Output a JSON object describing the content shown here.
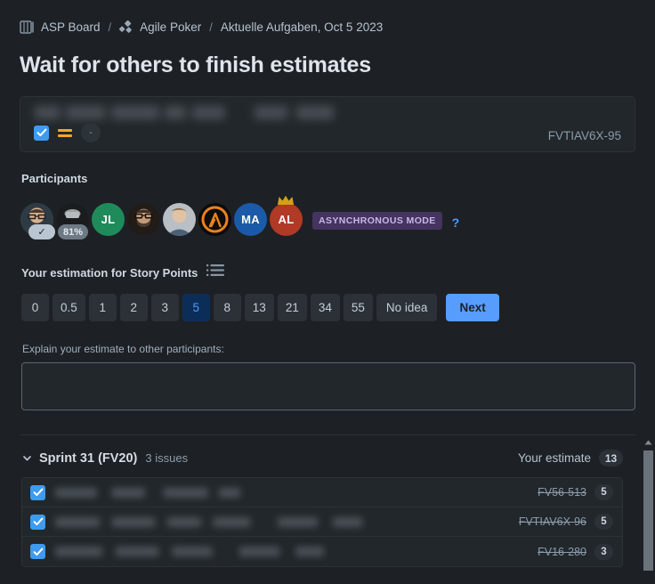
{
  "breadcrumb": {
    "board_icon": "board-icon",
    "board": "ASP Board",
    "sep1": "/",
    "poker_icon": "agile-poker-icon",
    "app": "Agile Poker",
    "sep2": "/",
    "session": "Aktuelle Aufgaben, Oct 5 2023"
  },
  "headline": "Wait for others to finish estimates",
  "issue_card": {
    "title_redacted": true,
    "checkbox_checked": true,
    "priority_icon": "priority-medium-icon",
    "assignee_placeholder": "-",
    "key": "FVTIAV6X-95"
  },
  "participants": {
    "label": "Participants",
    "avatars": [
      {
        "name": "participant-1",
        "type": "photo",
        "badge": "✓",
        "badge_type": "check",
        "color": "#3c4a55"
      },
      {
        "name": "participant-2",
        "type": "photo",
        "badge": "81%",
        "badge_type": "percent",
        "color": "#2a2d30"
      },
      {
        "name": "participant-3",
        "type": "initials",
        "initials": "JL",
        "color": "#1f8b5a"
      },
      {
        "name": "participant-4",
        "type": "photo",
        "color": "#2b2521"
      },
      {
        "name": "participant-5",
        "type": "photo",
        "color": "#6d7a86"
      },
      {
        "name": "participant-6",
        "type": "lambda",
        "color": "#101010",
        "accent": "#e8821e"
      },
      {
        "name": "participant-7",
        "type": "initials",
        "initials": "MA",
        "color": "#1a5aa8"
      },
      {
        "name": "participant-8",
        "type": "initials",
        "initials": "AL",
        "color": "#b03a26",
        "crown": true
      }
    ],
    "async_badge": "ASYNCHRONOUS MODE",
    "help": "?"
  },
  "estimation": {
    "label": "Your estimation for Story Points",
    "list_icon": "list-icon",
    "options": [
      "0",
      "0.5",
      "1",
      "2",
      "3",
      "5",
      "8",
      "13",
      "21",
      "34",
      "55",
      "No idea"
    ],
    "selected": "5",
    "next_label": "Next"
  },
  "explain": {
    "label": "Explain your estimate to other participants:",
    "value": "",
    "placeholder": ""
  },
  "sprint": {
    "caret_icon": "chevron-down-icon",
    "name": "Sprint 31 (FV20)",
    "issue_count": "3 issues",
    "your_estimate_label": "Your estimate",
    "your_estimate_total": "13",
    "issues": [
      {
        "checked": true,
        "title_redacted": true,
        "blur_width": 276,
        "key": "FV56-513",
        "estimate": "5"
      },
      {
        "checked": true,
        "title_redacted": true,
        "blur_width": 345,
        "key": "FVTIAV6X-96",
        "estimate": "5"
      },
      {
        "checked": true,
        "title_redacted": true,
        "blur_width": 302,
        "key": "FV16-280",
        "estimate": "3"
      }
    ]
  },
  "colors": {
    "background": "#1d2125",
    "surface": "#22272b",
    "accent_blue": "#579dff",
    "selected_blue": "#0c2d58",
    "checkbox_blue": "#3d9bf0",
    "priority_orange": "#f5a623",
    "async_purple": "#44345f",
    "async_text": "#c7b6e8"
  },
  "scrollbar": {
    "name": "vertical-scrollbar",
    "arrow": "scroll-up-arrow"
  }
}
